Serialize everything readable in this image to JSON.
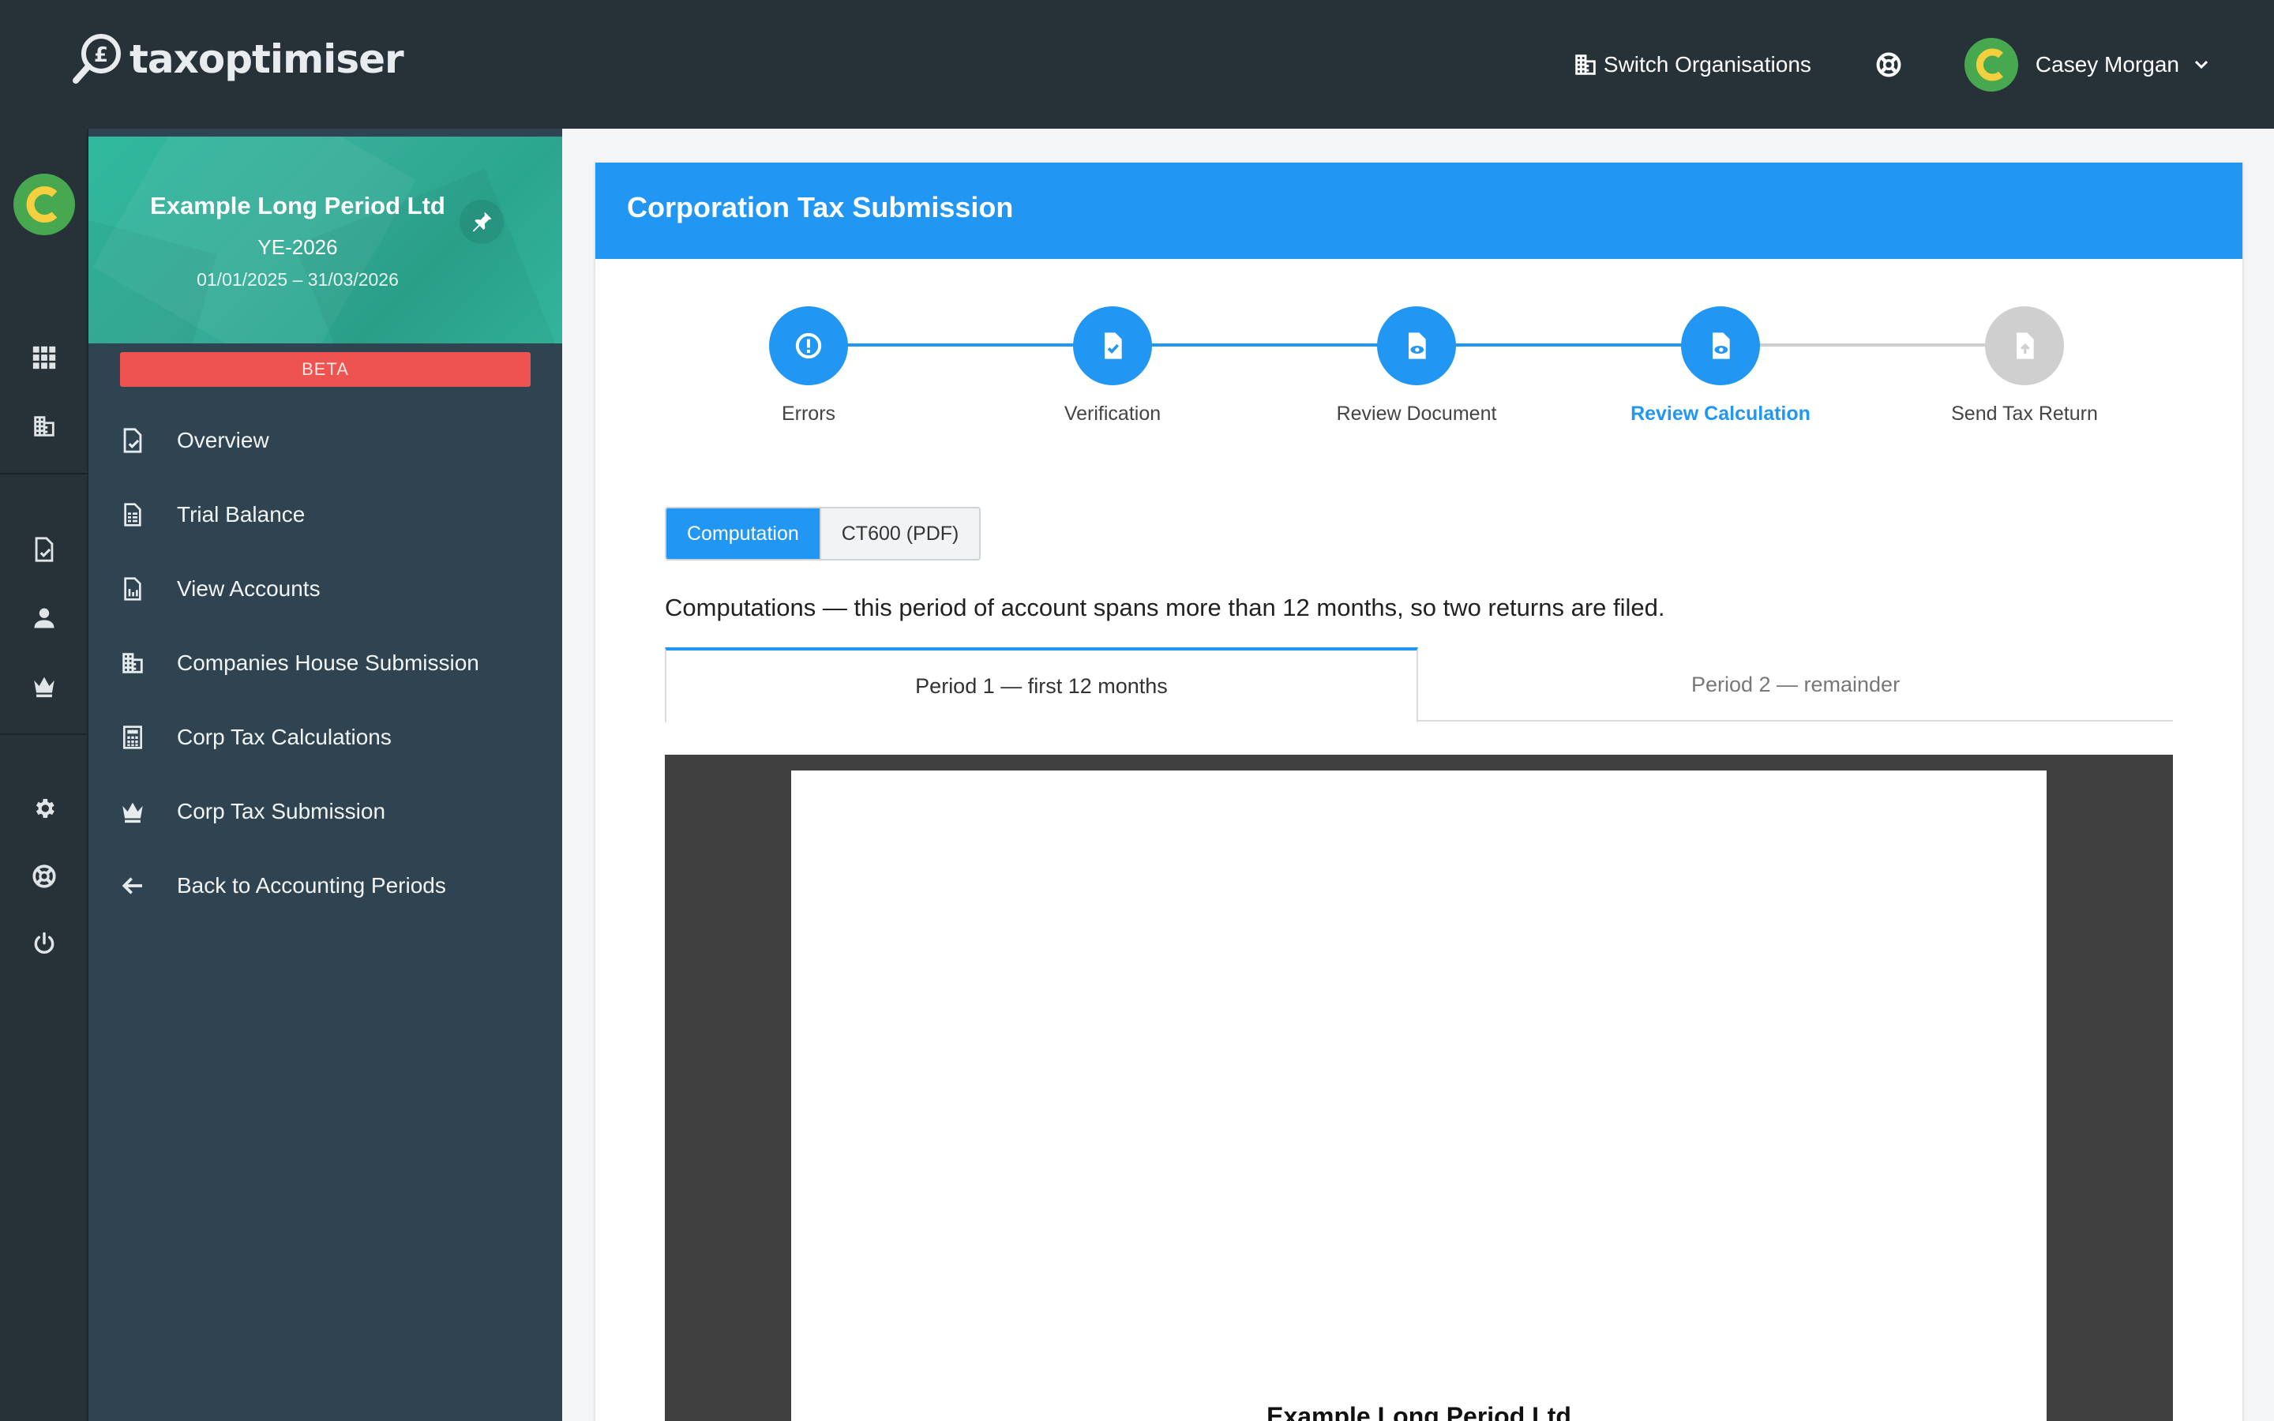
{
  "brand": {
    "name": "taxoptimiser"
  },
  "topbar": {
    "switch_org_label": "Switch Organisations",
    "user_name": "Casey Morgan",
    "avatar_letter": "C"
  },
  "sidebar": {
    "org_name": "Example Long Period Ltd",
    "year_end": "YE-2026",
    "period_dates": "01/01/2025 – 31/03/2026",
    "beta_label": "BETA",
    "items": [
      {
        "label": "Overview",
        "icon": "document-check-icon"
      },
      {
        "label": "Trial Balance",
        "icon": "spreadsheet-icon"
      },
      {
        "label": "View Accounts",
        "icon": "report-chart-icon"
      },
      {
        "label": "Companies House Submission",
        "icon": "buildings-icon"
      },
      {
        "label": "Corp Tax Calculations",
        "icon": "calculator-icon"
      },
      {
        "label": "Corp Tax Submission",
        "icon": "crown-icon"
      },
      {
        "label": "Back to Accounting Periods",
        "icon": "arrow-left-icon"
      }
    ]
  },
  "main": {
    "title": "Corporation Tax Submission",
    "steps": [
      {
        "label": "Errors",
        "state": "done"
      },
      {
        "label": "Verification",
        "state": "done"
      },
      {
        "label": "Review Document",
        "state": "done"
      },
      {
        "label": "Review Calculation",
        "state": "active"
      },
      {
        "label": "Send Tax Return",
        "state": "todo"
      }
    ],
    "segment": {
      "computation": "Computation",
      "ct600": "CT600 (PDF)",
      "selected": "Computation"
    },
    "note": "Computations — this period of account spans more than 12 months, so two returns are filed.",
    "tabs": [
      {
        "label": "Period 1 — first 12 months",
        "active": true
      },
      {
        "label": "Period 2 — remainder",
        "active": false
      }
    ],
    "document": {
      "heading": "Example Long Period Ltd"
    }
  },
  "colors": {
    "primary": "#2196f3",
    "topbar": "#263238",
    "sidebar": "#2f4450",
    "org_card": "#2fb99d",
    "beta": "#ef5350",
    "avatar": "#47a84f",
    "avatar_letter": "#f4d03f"
  }
}
